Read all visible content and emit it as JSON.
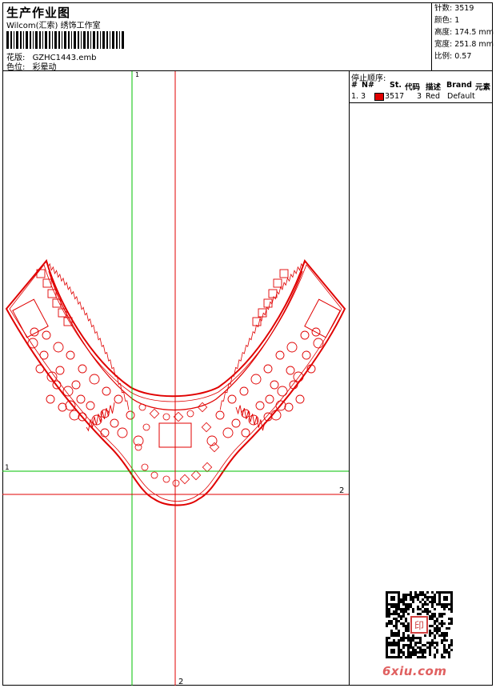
{
  "header": {
    "title": "生产作业图",
    "company": "Wilcom(汇索) 绣饰工作室",
    "design_label": "花版:",
    "design_value": "GZHC1443.emb",
    "colorway_label": "色位:",
    "colorway_value": "彩晕动"
  },
  "stats": {
    "stitches": "针数: 3519",
    "colors": "颜色: 1",
    "height": "高度: 174.5 mm",
    "width": "宽度: 251.8 mm",
    "scale": "比例: 0.57"
  },
  "stop_sequence": {
    "title": "停止顺序:",
    "columns": [
      "#",
      "N#",
      "St.",
      "代码",
      "描述",
      "Brand",
      "元素"
    ],
    "rows": [
      {
        "num": "1.",
        "needle": "3",
        "color": "#e00000",
        "stitches": "3517",
        "code": "3",
        "desc": "Red",
        "brand": "Default"
      }
    ]
  },
  "guides": {
    "v1": "1",
    "h1": "1",
    "v2": "2",
    "h2": "2"
  },
  "colors": {
    "design": "#e00000",
    "guide_green": "#00c000",
    "guide_red": "#e00000",
    "watermark": "#e06060"
  },
  "watermark": {
    "text": "6xiu.com",
    "seal_text": "印"
  }
}
